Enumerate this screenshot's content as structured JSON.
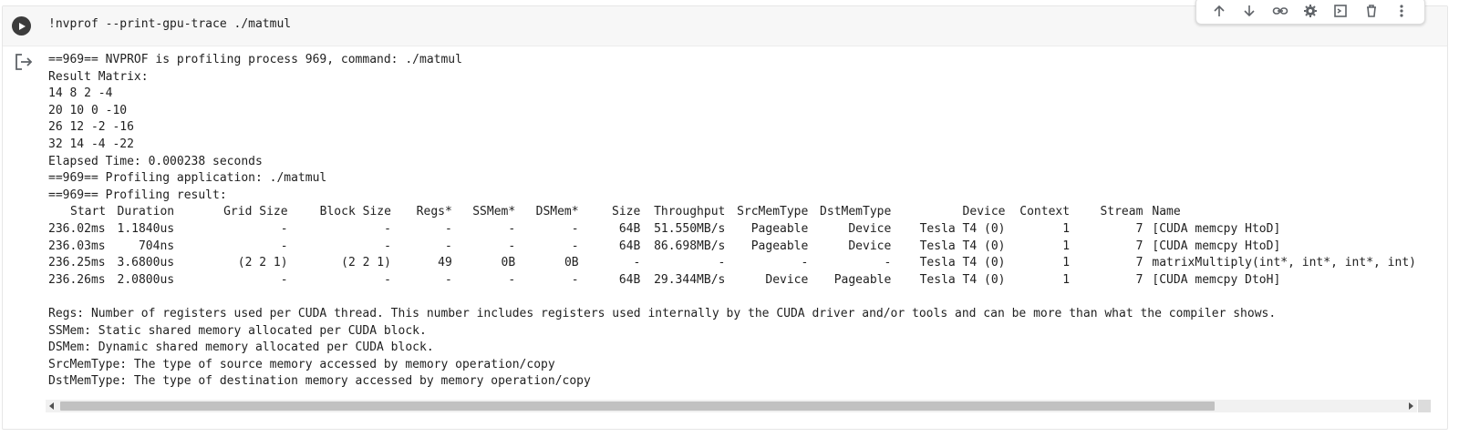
{
  "cell": {
    "code": "!nvprof --print-gpu-trace ./matmul"
  },
  "toolbar": {
    "icons": [
      "arrow-up-icon",
      "arrow-down-icon",
      "link-icon",
      "gear-icon",
      "mirror-cell-icon",
      "trash-icon",
      "more-vert-icon"
    ]
  },
  "output": {
    "lines_pre": [
      "==969== NVPROF is profiling process 969, command: ./matmul",
      "Result Matrix:",
      "14 8 2 -4",
      "20 10 0 -10",
      "26 12 -2 -16",
      "32 14 -4 -22",
      "Elapsed Time: 0.000238 seconds",
      "==969== Profiling application: ./matmul",
      "==969== Profiling result:"
    ],
    "table": {
      "headers": [
        "Start",
        "Duration",
        "Grid Size",
        "Block Size",
        "Regs*",
        "SSMem*",
        "DSMem*",
        "Size",
        "Throughput",
        "SrcMemType",
        "DstMemType",
        "Device",
        "Context",
        "Stream",
        "Name"
      ],
      "rows": [
        [
          "236.02ms",
          "1.1840us",
          "-",
          "-",
          "-",
          "-",
          "-",
          "64B",
          "51.550MB/s",
          "Pageable",
          "Device",
          "Tesla T4 (0)",
          "1",
          "7",
          "[CUDA memcpy HtoD]"
        ],
        [
          "236.03ms",
          "704ns",
          "-",
          "-",
          "-",
          "-",
          "-",
          "64B",
          "86.698MB/s",
          "Pageable",
          "Device",
          "Tesla T4 (0)",
          "1",
          "7",
          "[CUDA memcpy HtoD]"
        ],
        [
          "236.25ms",
          "3.6800us",
          "(2 2 1)",
          "(2 2 1)",
          "49",
          "0B",
          "0B",
          "-",
          "-",
          "-",
          "-",
          "Tesla T4 (0)",
          "1",
          "7",
          "matrixMultiply(int*, int*, int*, int)"
        ],
        [
          "236.26ms",
          "2.0800us",
          "-",
          "-",
          "-",
          "-",
          "-",
          "64B",
          "29.344MB/s",
          "Device",
          "Pageable",
          "Tesla T4 (0)",
          "1",
          "7",
          "[CUDA memcpy DtoH]"
        ]
      ]
    },
    "lines_post": [
      "",
      "Regs: Number of registers used per CUDA thread. This number includes registers used internally by the CUDA driver and/or tools and can be more than what the compiler shows.",
      "SSMem: Static shared memory allocated per CUDA block.",
      "DSMem: Dynamic shared memory allocated per CUDA block.",
      "SrcMemType: The type of source memory accessed by memory operation/copy",
      "DstMemType: The type of destination memory accessed by memory operation/copy"
    ]
  },
  "scrollbar": {
    "position_fraction": 0.0,
    "visible_fraction": 0.86
  }
}
